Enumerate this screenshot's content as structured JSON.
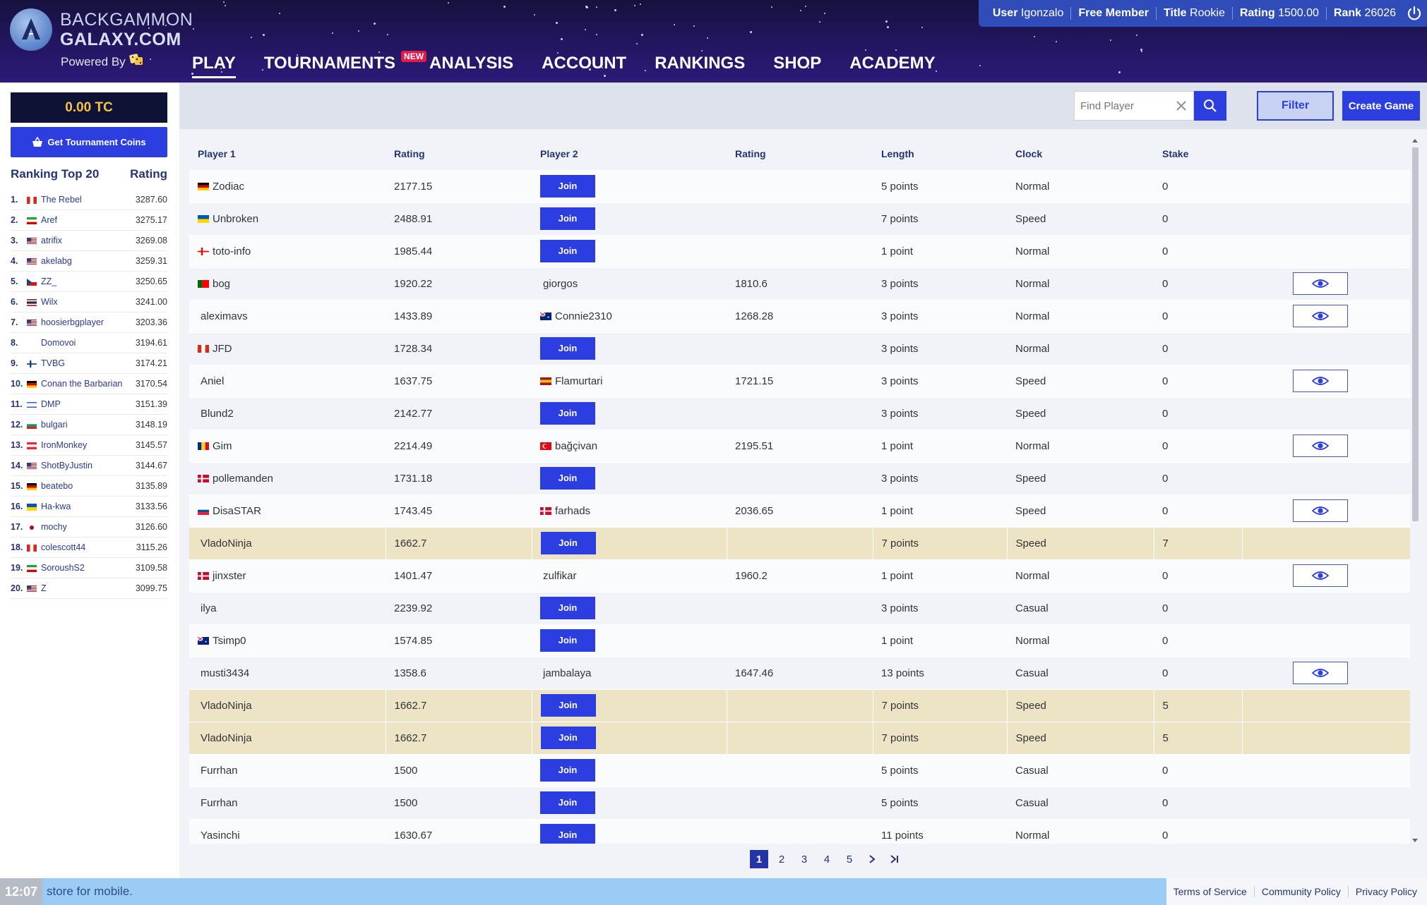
{
  "header": {
    "logo_line1": "BACKGAMMON",
    "logo_line2": "GALAXY.COM",
    "powered_by": "Powered By",
    "nav": [
      {
        "label": "PLAY",
        "active": true
      },
      {
        "label": "TOURNAMENTS",
        "badge": "NEW"
      },
      {
        "label": "ANALYSIS"
      },
      {
        "label": "ACCOUNT"
      },
      {
        "label": "RANKINGS"
      },
      {
        "label": "SHOP"
      },
      {
        "label": "ACADEMY"
      }
    ],
    "user": {
      "user_key": "User",
      "user_val": "Igonzalo",
      "membership": "Free Member",
      "title_key": "Title",
      "title_val": "Rookie",
      "rating_key": "Rating",
      "rating_val": "1500.00",
      "rank_key": "Rank",
      "rank_val": "26026"
    }
  },
  "sidebar": {
    "coins": "0.00 TC",
    "get_coins": "Get Tournament Coins",
    "ranking_title": "Ranking Top 20",
    "ranking_col": "Rating",
    "ranking": [
      {
        "n": "1.",
        "name": "The Rebel",
        "rating": "3287.60",
        "flag": "ca"
      },
      {
        "n": "2.",
        "name": "Aref",
        "rating": "3275.17",
        "flag": "ir"
      },
      {
        "n": "3.",
        "name": "atrifix",
        "rating": "3269.08",
        "flag": "us"
      },
      {
        "n": "4.",
        "name": "akelabg",
        "rating": "3259.31",
        "flag": "us"
      },
      {
        "n": "5.",
        "name": "ZZ_",
        "rating": "3250.65",
        "flag": "cz"
      },
      {
        "n": "6.",
        "name": "Wilx",
        "rating": "3241.00",
        "flag": "th"
      },
      {
        "n": "7.",
        "name": "hoosierbgplayer",
        "rating": "3203.36",
        "flag": "us"
      },
      {
        "n": "8.",
        "name": "Domovoi",
        "rating": "3194.61",
        "flag": ""
      },
      {
        "n": "9.",
        "name": "TVBG",
        "rating": "3174.21",
        "flag": "fi"
      },
      {
        "n": "10.",
        "name": "Conan the Barbarian",
        "rating": "3170.54",
        "flag": "de"
      },
      {
        "n": "11.",
        "name": "DMP",
        "rating": "3151.39",
        "flag": "il"
      },
      {
        "n": "12.",
        "name": "bulgari",
        "rating": "3148.19",
        "flag": "bg"
      },
      {
        "n": "13.",
        "name": "IronMonkey",
        "rating": "3145.57",
        "flag": "at"
      },
      {
        "n": "14.",
        "name": "ShotByJustin",
        "rating": "3144.67",
        "flag": "us"
      },
      {
        "n": "15.",
        "name": "beatebo",
        "rating": "3135.89",
        "flag": "de"
      },
      {
        "n": "16.",
        "name": "Ha-kwa",
        "rating": "3133.56",
        "flag": "ua"
      },
      {
        "n": "17.",
        "name": "mochy",
        "rating": "3126.60",
        "flag": "jp"
      },
      {
        "n": "18.",
        "name": "colescott44",
        "rating": "3115.26",
        "flag": "ca"
      },
      {
        "n": "19.",
        "name": "SoroushS2",
        "rating": "3109.58",
        "flag": "ir"
      },
      {
        "n": "20.",
        "name": "Z",
        "rating": "3099.75",
        "flag": "us"
      }
    ]
  },
  "toolbar": {
    "search_placeholder": "Find Player",
    "filter": "Filter",
    "create": "Create Game"
  },
  "table": {
    "columns": [
      "Player 1",
      "Rating",
      "Player 2",
      "Rating",
      "Length",
      "Clock",
      "Stake",
      ""
    ],
    "join_label": "Join",
    "rows": [
      {
        "p1": "Zodiac",
        "f1": "de",
        "r1": "2177.15",
        "p2": "",
        "f2": "",
        "r2": "",
        "len": "5 points",
        "clock": "Normal",
        "stake": "0",
        "watch": false,
        "hl": false
      },
      {
        "p1": "Unbroken",
        "f1": "ua",
        "r1": "2488.91",
        "p2": "",
        "f2": "",
        "r2": "",
        "len": "7 points",
        "clock": "Speed",
        "stake": "0",
        "watch": false,
        "hl": false
      },
      {
        "p1": "toto-info",
        "f1": "ge",
        "r1": "1985.44",
        "p2": "",
        "f2": "",
        "r2": "",
        "len": "1 point",
        "clock": "Normal",
        "stake": "0",
        "watch": false,
        "hl": false
      },
      {
        "p1": "bog",
        "f1": "pt",
        "r1": "1920.22",
        "p2": "giorgos",
        "f2": "",
        "r2": "1810.6",
        "len": "3 points",
        "clock": "Normal",
        "stake": "0",
        "watch": true,
        "hl": false
      },
      {
        "p1": "aleximavs",
        "f1": "",
        "r1": "1433.89",
        "p2": "Connie2310",
        "f2": "au",
        "r2": "1268.28",
        "len": "3 points",
        "clock": "Normal",
        "stake": "0",
        "watch": true,
        "hl": false
      },
      {
        "p1": "JFD",
        "f1": "ca",
        "r1": "1728.34",
        "p2": "",
        "f2": "",
        "r2": "",
        "len": "3 points",
        "clock": "Normal",
        "stake": "0",
        "watch": false,
        "hl": false
      },
      {
        "p1": "Aniel",
        "f1": "",
        "r1": "1637.75",
        "p2": "Flamurtari",
        "f2": "es",
        "r2": "1721.15",
        "len": "3 points",
        "clock": "Speed",
        "stake": "0",
        "watch": true,
        "hl": false
      },
      {
        "p1": "Blund2",
        "f1": "",
        "r1": "2142.77",
        "p2": "",
        "f2": "",
        "r2": "",
        "len": "3 points",
        "clock": "Speed",
        "stake": "0",
        "watch": false,
        "hl": false
      },
      {
        "p1": "Gim",
        "f1": "ro",
        "r1": "2214.49",
        "p2": "bağçivan",
        "f2": "tr",
        "r2": "2195.51",
        "len": "1 point",
        "clock": "Normal",
        "stake": "0",
        "watch": true,
        "hl": false
      },
      {
        "p1": "pollemanden",
        "f1": "dk",
        "r1": "1731.18",
        "p2": "",
        "f2": "",
        "r2": "",
        "len": "3 points",
        "clock": "Speed",
        "stake": "0",
        "watch": false,
        "hl": false
      },
      {
        "p1": "DisaSTAR",
        "f1": "sk",
        "r1": "1743.45",
        "p2": "farhads",
        "f2": "dk",
        "r2": "2036.65",
        "len": "1 point",
        "clock": "Speed",
        "stake": "0",
        "watch": true,
        "hl": false
      },
      {
        "p1": "VladoNinja",
        "f1": "",
        "r1": "1662.7",
        "p2": "",
        "f2": "",
        "r2": "",
        "len": "7 points",
        "clock": "Speed",
        "stake": "7",
        "watch": false,
        "hl": true
      },
      {
        "p1": "jinxster",
        "f1": "dk",
        "r1": "1401.47",
        "p2": "zulfikar",
        "f2": "",
        "r2": "1960.2",
        "len": "1 point",
        "clock": "Normal",
        "stake": "0",
        "watch": true,
        "hl": false
      },
      {
        "p1": "ilya",
        "f1": "",
        "r1": "2239.92",
        "p2": "",
        "f2": "",
        "r2": "",
        "len": "3 points",
        "clock": "Casual",
        "stake": "0",
        "watch": false,
        "hl": false
      },
      {
        "p1": "Tsimp0",
        "f1": "au",
        "r1": "1574.85",
        "p2": "",
        "f2": "",
        "r2": "",
        "len": "1 point",
        "clock": "Normal",
        "stake": "0",
        "watch": false,
        "hl": false
      },
      {
        "p1": "musti3434",
        "f1": "",
        "r1": "1358.6",
        "p2": "jambalaya",
        "f2": "",
        "r2": "1647.46",
        "len": "13 points",
        "clock": "Casual",
        "stake": "0",
        "watch": true,
        "hl": false
      },
      {
        "p1": "VladoNinja",
        "f1": "",
        "r1": "1662.7",
        "p2": "",
        "f2": "",
        "r2": "",
        "len": "7 points",
        "clock": "Speed",
        "stake": "5",
        "watch": false,
        "hl": true
      },
      {
        "p1": "VladoNinja",
        "f1": "",
        "r1": "1662.7",
        "p2": "",
        "f2": "",
        "r2": "",
        "len": "7 points",
        "clock": "Speed",
        "stake": "5",
        "watch": false,
        "hl": true
      },
      {
        "p1": "Furrhan",
        "f1": "",
        "r1": "1500",
        "p2": "",
        "f2": "",
        "r2": "",
        "len": "5 points",
        "clock": "Casual",
        "stake": "0",
        "watch": false,
        "hl": false
      },
      {
        "p1": "Furrhan",
        "f1": "",
        "r1": "1500",
        "p2": "",
        "f2": "",
        "r2": "",
        "len": "5 points",
        "clock": "Casual",
        "stake": "0",
        "watch": false,
        "hl": false
      },
      {
        "p1": "Yasinchi",
        "f1": "",
        "r1": "1630.67",
        "p2": "",
        "f2": "",
        "r2": "",
        "len": "11 points",
        "clock": "Normal",
        "stake": "0",
        "watch": false,
        "hl": false
      }
    ]
  },
  "pagination": {
    "pages": [
      "1",
      "2",
      "3",
      "4",
      "5"
    ],
    "current": "1"
  },
  "footer": {
    "clock": "12:07",
    "message": "store for mobile.",
    "links": [
      "Terms of Service",
      "Community Policy",
      "Privacy Policy"
    ]
  },
  "colors": {
    "accent": "#2d3ee0",
    "header": "#231661",
    "coins": "#f6c344",
    "stake_row": "#ede4c6"
  },
  "icons": [
    "logo-icon",
    "dice-icon",
    "power-icon",
    "basket-icon",
    "clear-icon",
    "search-icon",
    "eye-icon",
    "chevron-right-icon",
    "last-page-icon"
  ]
}
